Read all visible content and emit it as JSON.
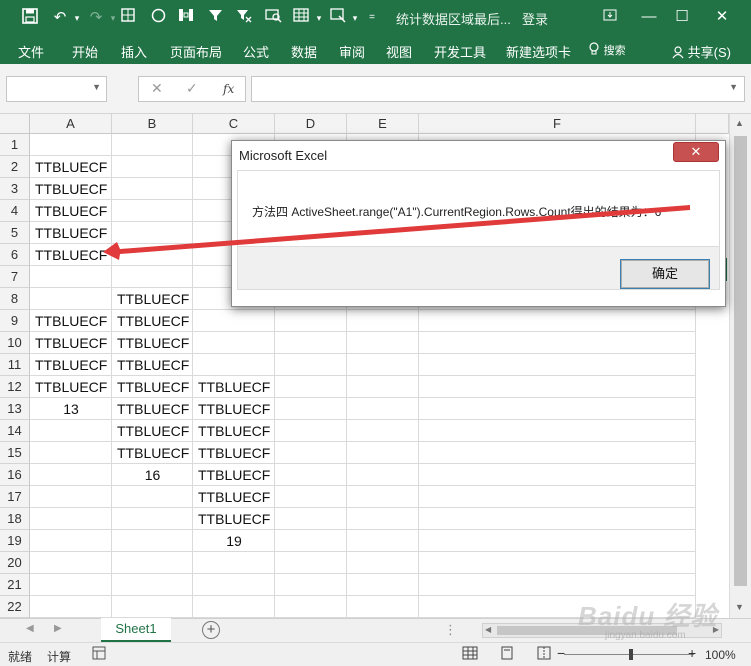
{
  "titlebar": {
    "qat_icons": [
      "save-icon",
      "undo-icon",
      "redo-icon",
      "borders-icon",
      "shape-icon",
      "column-icon",
      "filter-icon",
      "clear-filter-icon",
      "find-icon",
      "table-icon",
      "screenshot-icon",
      "customize-icon"
    ],
    "title": "统计数据区域最后...",
    "login": "登录",
    "bg_color": "#217346"
  },
  "ribbon": {
    "tabs": [
      "文件",
      "开始",
      "插入",
      "页面布局",
      "公式",
      "数据",
      "审阅",
      "视图",
      "开发工具",
      "新建选项卡"
    ],
    "search": "搜索",
    "share": "共享(S)"
  },
  "formula_bar": {
    "name_box": "",
    "cancel": "✕",
    "enter": "✓",
    "fx": "fx",
    "formula": ""
  },
  "columns": [
    "A",
    "B",
    "C",
    "D",
    "E",
    "F"
  ],
  "rows": [
    "1",
    "2",
    "3",
    "4",
    "5",
    "6",
    "7",
    "8",
    "9",
    "10",
    "11",
    "12",
    "13",
    "14",
    "15",
    "16",
    "17",
    "18",
    "19",
    "20",
    "21",
    "22"
  ],
  "cells": {
    "A2": "TTBLUECF",
    "A3": "TTBLUECF",
    "A4": "TTBLUECF",
    "A5": "TTBLUECF",
    "A6": "TTBLUECF",
    "A9": "TTBLUECF",
    "A10": "TTBLUECF",
    "A11": "TTBLUECF",
    "A12": "TTBLUECF",
    "A13": "13",
    "B8": "TTBLUECF",
    "B9": "TTBLUECF",
    "B10": "TTBLUECF",
    "B11": "TTBLUECF",
    "B12": "TTBLUECF",
    "B13": "TTBLUECF",
    "B14": "TTBLUECF",
    "B15": "TTBLUECF",
    "B16": "16",
    "C12": "TTBLUECF",
    "C13": "TTBLUECF",
    "C14": "TTBLUECF",
    "C15": "TTBLUECF",
    "C16": "TTBLUECF",
    "C17": "TTBLUECF",
    "C18": "TTBLUECF",
    "C19": "19"
  },
  "sheet_tabs": [
    "Sheet1"
  ],
  "statusbar": {
    "ready": "就绪",
    "calc": "计算",
    "zoom": "100%"
  },
  "dialog": {
    "title": "Microsoft Excel",
    "close": "✕",
    "message": "方法四  ActiveSheet.range(\"A1\").CurrentRegion.Rows.Count得出的结果为：6",
    "ok": "确定"
  },
  "annotation": {
    "arrow_color": "#e03a3a"
  },
  "watermark": {
    "text": "Baidu 经验",
    "sub": "jingyan.baidu.com"
  }
}
